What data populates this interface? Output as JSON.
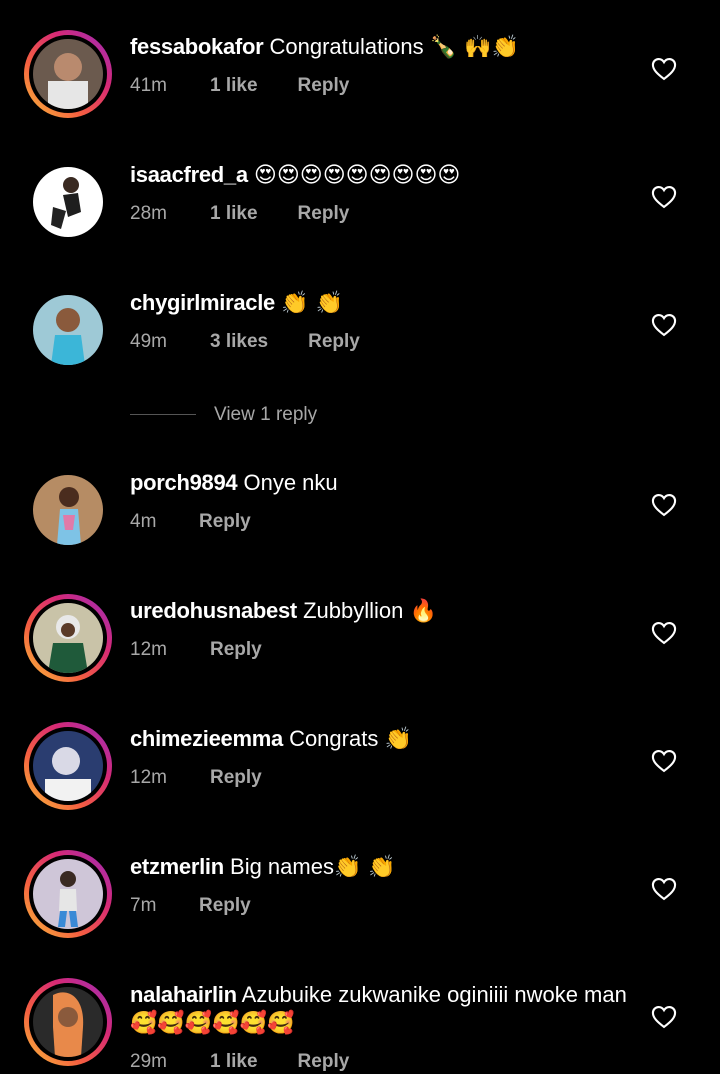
{
  "comments": [
    {
      "username": "fessabokafor",
      "text": "Congratulations",
      "emoji": "🍾 🙌👏",
      "time": "41m",
      "likes": "1 like",
      "reply": "Reply",
      "story_ring": true,
      "avatar_color": "#b98a6e"
    },
    {
      "username": "isaacfred_a",
      "text": "",
      "emoji": "😍😍😍😍😍😍😍😍😍",
      "time": "28m",
      "likes": "1 like",
      "reply": "Reply",
      "story_ring": false,
      "avatar_color": "#ffffff"
    },
    {
      "username": "chygirlmiracle",
      "text": "",
      "emoji": "👏 👏",
      "time": "49m",
      "likes": "3 likes",
      "reply": "Reply",
      "story_ring": false,
      "avatar_color": "#6fc4d9"
    },
    {
      "username": "porch9894",
      "text": "Onye nku",
      "emoji": "",
      "time": "4m",
      "likes": "",
      "reply": "Reply",
      "story_ring": false,
      "avatar_color": "#c9a27a"
    },
    {
      "username": "uredohusnabest",
      "text": "Zubbyllion",
      "emoji": "🔥",
      "time": "12m",
      "likes": "",
      "reply": "Reply",
      "story_ring": true,
      "avatar_color": "#6f8f5a"
    },
    {
      "username": "chimezieemma",
      "text": "Congrats",
      "emoji": "👏",
      "time": "12m",
      "likes": "",
      "reply": "Reply",
      "story_ring": true,
      "avatar_color": "#4a6fb0"
    },
    {
      "username": "etzmerlin",
      "text": "Big names",
      "emoji": "👏 👏",
      "time": "7m",
      "likes": "",
      "reply": "Reply",
      "story_ring": true,
      "avatar_color": "#c8a9c4"
    },
    {
      "username": "nalahairlin",
      "text": "Azubuike zukwanike oginiiii nwoke man",
      "emoji": "🥰🥰🥰🥰🥰🥰",
      "time": "29m",
      "likes": "1 like",
      "reply": "Reply",
      "story_ring": true,
      "avatar_color": "#e8894a"
    }
  ],
  "view_replies": "View 1 reply",
  "icons": {
    "like": "heart-outline-icon"
  },
  "colors": {
    "background": "#000000",
    "text": "#ffffff",
    "meta": "#a8a8a8",
    "ring": "#d62976"
  }
}
